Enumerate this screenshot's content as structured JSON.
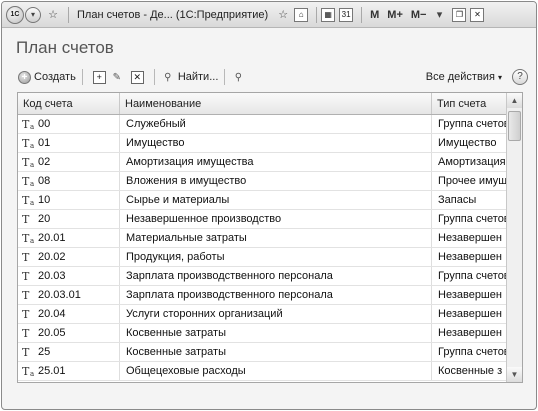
{
  "titlebar": {
    "logo_text": "1С",
    "window_title": "План счетов - Де... (1С:Предприятие)",
    "memory_buttons": [
      "M",
      "M+",
      "M−"
    ]
  },
  "form": {
    "title": "План счетов"
  },
  "toolbar": {
    "create_label": "Создать",
    "find_label": "Найти...",
    "actions_label": "Все действия",
    "help_label": "?"
  },
  "table": {
    "columns": [
      "Код счета",
      "Наименование",
      "Тип счета"
    ],
    "rows": [
      {
        "code": "00",
        "name": "Служебный",
        "type": "Группа счетов",
        "subconto": true
      },
      {
        "code": "01",
        "name": "Имущество",
        "type": "Имущество",
        "subconto": true
      },
      {
        "code": "02",
        "name": "Амортизация имущества",
        "type": "Амортизация",
        "subconto": true
      },
      {
        "code": "08",
        "name": "Вложения в имущество",
        "type": "Прочее имущ",
        "subconto": true
      },
      {
        "code": "10",
        "name": "Сырье и материалы",
        "type": "Запасы",
        "subconto": true
      },
      {
        "code": "20",
        "name": "Незавершенное производство",
        "type": "Группа счетов",
        "subconto": false
      },
      {
        "code": "20.01",
        "name": "Материальные затраты",
        "type": "Незавершен",
        "subconto": true
      },
      {
        "code": "20.02",
        "name": "Продукция, работы",
        "type": "Незавершен",
        "subconto": false
      },
      {
        "code": "20.03",
        "name": "Зарплата производственного персонала",
        "type": "Группа счетов",
        "subconto": false
      },
      {
        "code": "20.03.01",
        "name": "Зарплата производственного персонала",
        "type": "Незавершен",
        "subconto": false
      },
      {
        "code": "20.04",
        "name": "Услуги сторонних организаций",
        "type": "Незавершен",
        "subconto": false
      },
      {
        "code": "20.05",
        "name": "Косвенные затраты",
        "type": "Незавершен",
        "subconto": false
      },
      {
        "code": "25",
        "name": "Косвенные затраты",
        "type": "Группа счетов",
        "subconto": false
      },
      {
        "code": "25.01",
        "name": "Общецеховые расходы",
        "type": "Косвенные з",
        "subconto": true
      }
    ]
  }
}
